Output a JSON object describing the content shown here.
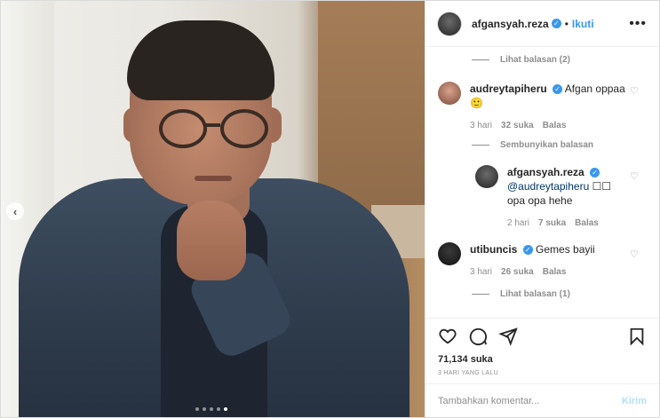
{
  "post": {
    "carousel_dots": 5,
    "active_dot": 4
  },
  "header": {
    "username": "afgansyah.reza",
    "separator": "•",
    "follow_label": "Ikuti",
    "more_label": "•••"
  },
  "comments": {
    "view_replies_top": "Lihat balasan (2)",
    "items": [
      {
        "username": "audreytapiheru",
        "text": "Afgan oppaa",
        "emoji": "🙂",
        "time": "3 hari",
        "likes": "32 suka",
        "reply_label": "Balas"
      },
      {
        "username": "utibuncis",
        "text": "Gemes bayii",
        "time": "3 hari",
        "likes": "26 suka",
        "reply_label": "Balas"
      }
    ],
    "hide_replies": "Sembunyikan balasan",
    "reply": {
      "username": "afgansyah.reza",
      "mention": "@audreytapiheru",
      "text_suffix": "☐☐",
      "text_line2": "opa opa hehe",
      "time": "2 hari",
      "likes": "7 suka",
      "reply_label": "Balas"
    },
    "view_replies_bottom": "Lihat balasan (1)"
  },
  "footer": {
    "likes": "71,134 suka",
    "timestamp": "3 HARI YANG LALU",
    "comment_placeholder": "Tambahkan komentar...",
    "post_label": "Kirim"
  },
  "colors": {
    "verified": "#3897f0",
    "follow": "#3897f0",
    "post_disabled": "#b2dffc",
    "muted": "#8e8e8e"
  }
}
